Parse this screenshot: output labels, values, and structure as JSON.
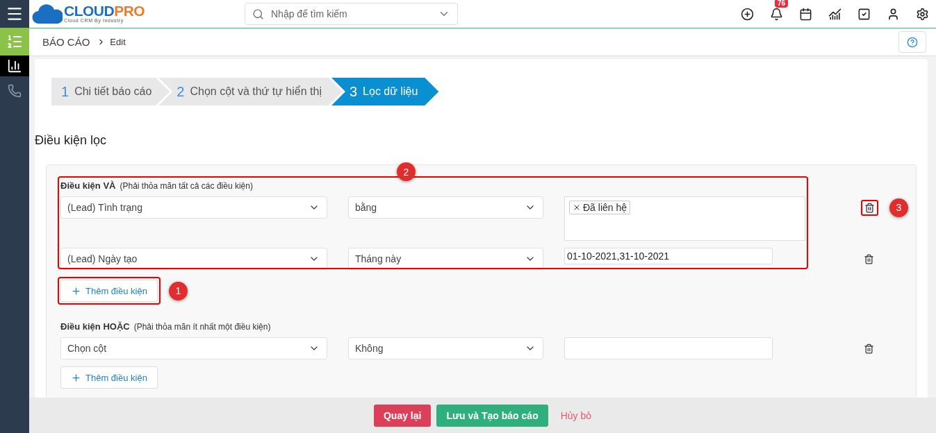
{
  "header": {
    "logo_main": "CLOUD",
    "logo_accent": "PRO",
    "logo_tagline": "Cloud CRM By Industry",
    "search": {
      "placeholder": "Nhập để tìm kiếm"
    },
    "notification_count": "76"
  },
  "sidebar": {
    "items": [
      {
        "kind": "reports",
        "selected": true
      },
      {
        "kind": "chart",
        "selected": false
      },
      {
        "kind": "phone",
        "selected": false
      }
    ]
  },
  "breadcrumb": {
    "section": "BÁO CÁO",
    "page": "Edit"
  },
  "steps": [
    {
      "number": "1",
      "label": "Chi tiết báo cáo",
      "selected": false
    },
    {
      "number": "2",
      "label": "Chọn cột và thứ tự hiển thị",
      "selected": false
    },
    {
      "number": "3",
      "label": "Lọc dữ liệu",
      "selected": true
    }
  ],
  "section_title": "Điều kiện lọc",
  "groups": [
    {
      "title": "Điều kiện VÀ",
      "note": "(Phải thỏa mãn tất cả các điều kiện)",
      "frame_marker": "2",
      "add_button": "Thêm điều kiện",
      "add_marker": "1",
      "conditions": [
        {
          "field": "(Lead) Tình trạng",
          "operator": "bằng",
          "kind": "tags",
          "tags": [
            "Đã liên hệ"
          ],
          "delete_marker": "3"
        },
        {
          "field": "(Lead) Ngày tạo",
          "operator": "Tháng này",
          "kind": "text",
          "value": "01-10-2021,31-10-2021"
        }
      ]
    },
    {
      "title": "Điều kiện HOẶC",
      "note": "(Phải thỏa mãn ít nhất một điều kiện)",
      "add_button": "Thêm điều kiện",
      "conditions": [
        {
          "field": "Chọn cột",
          "operator": "Không",
          "kind": "text"
        }
      ]
    }
  ],
  "footer": {
    "back": "Quay lại",
    "save": "Lưu và Tạo báo cáo",
    "cancel": "Hủy bỏ"
  }
}
